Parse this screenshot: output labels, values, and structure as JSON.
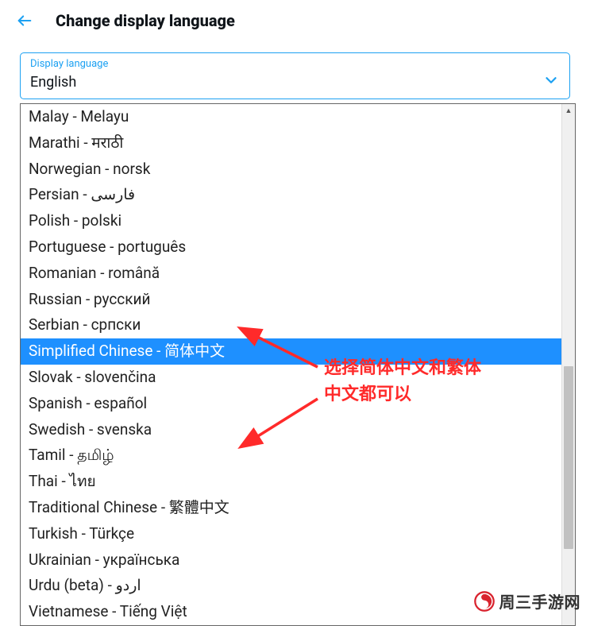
{
  "header": {
    "title": "Change display language"
  },
  "select": {
    "label": "Display language",
    "value": "English"
  },
  "options": [
    {
      "label": "Malay - Melayu",
      "highlighted": false
    },
    {
      "label": "Marathi - मराठी",
      "highlighted": false
    },
    {
      "label": "Norwegian - norsk",
      "highlighted": false
    },
    {
      "label": "Persian - فارسی",
      "highlighted": false
    },
    {
      "label": "Polish - polski",
      "highlighted": false
    },
    {
      "label": "Portuguese - português",
      "highlighted": false
    },
    {
      "label": "Romanian - română",
      "highlighted": false
    },
    {
      "label": "Russian - русский",
      "highlighted": false
    },
    {
      "label": "Serbian - српски",
      "highlighted": false
    },
    {
      "label": "Simplified Chinese - 简体中文",
      "highlighted": true
    },
    {
      "label": "Slovak - slovenčina",
      "highlighted": false
    },
    {
      "label": "Spanish - español",
      "highlighted": false
    },
    {
      "label": "Swedish - svenska",
      "highlighted": false
    },
    {
      "label": "Tamil - தமிழ்",
      "highlighted": false
    },
    {
      "label": "Thai - ไทย",
      "highlighted": false
    },
    {
      "label": "Traditional Chinese - 繁體中文",
      "highlighted": false
    },
    {
      "label": "Turkish - Türkçe",
      "highlighted": false
    },
    {
      "label": "Ukrainian - українська",
      "highlighted": false
    },
    {
      "label": "Urdu (beta) - اردو",
      "highlighted": false
    },
    {
      "label": "Vietnamese - Tiếng Việt",
      "highlighted": false
    }
  ],
  "annotation": {
    "line1": "选择简体中文和繁体",
    "line2": "中文都可以"
  },
  "watermark": {
    "text": "周三手游网"
  }
}
